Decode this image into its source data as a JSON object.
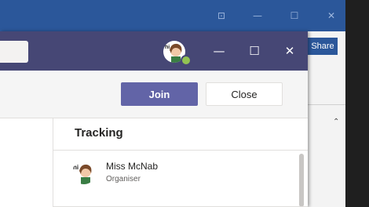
{
  "word": {
    "share_label": "Share",
    "controls": {
      "tile": "⊡",
      "minimize": "—",
      "maximize": "☐",
      "close": "✕"
    },
    "caret": "⌃"
  },
  "teams": {
    "controls": {
      "minimize": "—",
      "maximize": "☐",
      "close": "✕"
    },
    "actions": {
      "join_label": "Join",
      "close_label": "Close"
    },
    "tracking": {
      "title": "Tracking",
      "people": [
        {
          "name": "Miss McNab",
          "role": "Organiser"
        }
      ]
    }
  },
  "colors": {
    "teams_purple": "#464775",
    "join_purple": "#6264a7",
    "word_blue": "#2b579a",
    "presence_green": "#92c353"
  }
}
